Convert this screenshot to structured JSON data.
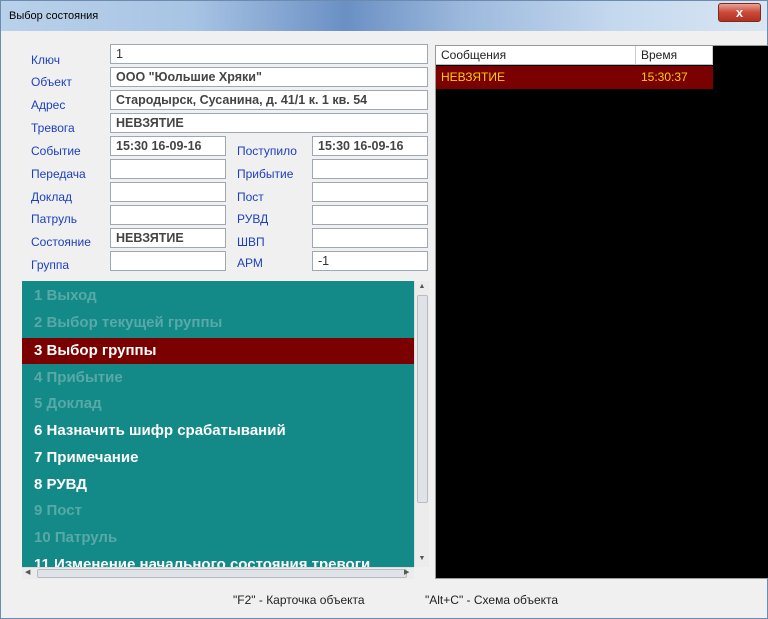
{
  "window": {
    "title": "Выбор состояния",
    "close_label": "x"
  },
  "fields": {
    "key": {
      "label": "Ключ",
      "value": "1"
    },
    "object": {
      "label": "Объект",
      "value": "ООО \"Юольшие Хряки\""
    },
    "address": {
      "label": "Адрес",
      "value": "Стародырск, Сусанина, д. 41/1 к. 1 кв. 54"
    },
    "alarm": {
      "label": "Тревога",
      "value": "НЕВЗЯТИЕ"
    },
    "event": {
      "label": "Событие",
      "value": "15:30 16-09-16"
    },
    "transfer": {
      "label": "Передача",
      "value": ""
    },
    "report": {
      "label": "Доклад",
      "value": ""
    },
    "patrol": {
      "label": "Патруль",
      "value": ""
    },
    "state": {
      "label": "Состояние",
      "value": "НЕВЗЯТИЕ"
    },
    "group": {
      "label": "Группа",
      "value": ""
    },
    "received": {
      "label": "Поступило",
      "value": "15:30 16-09-16"
    },
    "arrival": {
      "label": "Прибытие",
      "value": ""
    },
    "post": {
      "label": "Пост",
      "value": ""
    },
    "ruvd": {
      "label": "РУВД",
      "value": ""
    },
    "shvp": {
      "label": "ШВП",
      "value": ""
    },
    "arm": {
      "label": "АРМ",
      "value": "-1"
    }
  },
  "menu": {
    "items": [
      {
        "label": "1 Выход",
        "state": "disabled"
      },
      {
        "label": "2 Выбор текущей группы",
        "state": "disabled"
      },
      {
        "label": "3 Выбор группы",
        "state": "selected"
      },
      {
        "label": "4 Прибытие",
        "state": "disabled"
      },
      {
        "label": "5 Доклад",
        "state": "disabled"
      },
      {
        "label": "6 Назначить шифр срабатываний",
        "state": "enabled"
      },
      {
        "label": "7 Примечание",
        "state": "enabled"
      },
      {
        "label": "8 РУВД",
        "state": "enabled"
      },
      {
        "label": "9 Пост",
        "state": "disabled"
      },
      {
        "label": "10 Патруль",
        "state": "disabled"
      },
      {
        "label": "11 Изменение начального состояния тревоги",
        "state": "enabled"
      }
    ]
  },
  "messages": {
    "columns": [
      "Сообщения",
      "Время"
    ],
    "rows": [
      {
        "message": "НЕВЗЯТИЕ",
        "time": "15:30:37"
      }
    ]
  },
  "footer": {
    "hint_f2": "\"F2\" - Карточка объекта",
    "hint_altc": "\"Alt+C\" - Схема объекта"
  },
  "colors": {
    "menu_bg": "#138988",
    "selected_bg": "#7b0000",
    "disabled_text": "#58a9a7",
    "label_text": "#1c3fbf",
    "message_text": "#ffcc00"
  }
}
